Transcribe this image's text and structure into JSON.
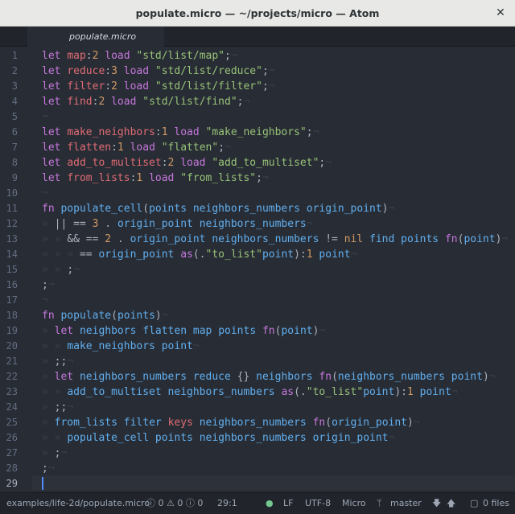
{
  "window": {
    "title": "populate.micro — ~/projects/micro — Atom"
  },
  "tabs": [
    {
      "label": "populate.micro"
    }
  ],
  "editor": {
    "active_line": 29,
    "line_numbers": [
      "1",
      "2",
      "3",
      "4",
      "5",
      "6",
      "7",
      "8",
      "9",
      "10",
      "11",
      "12",
      "13",
      "14",
      "15",
      "16",
      "17",
      "18",
      "19",
      "20",
      "21",
      "22",
      "23",
      "24",
      "25",
      "26",
      "27",
      "28",
      "29"
    ]
  },
  "statusbar": {
    "file_path": "examples/life-2d/populate.micro",
    "errors": "0",
    "warnings": "0",
    "infos": "0",
    "cursor_position": "29:1",
    "line_ending": "LF",
    "encoding": "UTF-8",
    "grammar": "Micro",
    "branch": "master",
    "files": "0 files"
  },
  "colors": {
    "keyword": "#c678dd",
    "function": "#61afef",
    "number": "#d19a66",
    "string": "#98c379",
    "variable": "#e06c75",
    "background": "#282c34"
  }
}
